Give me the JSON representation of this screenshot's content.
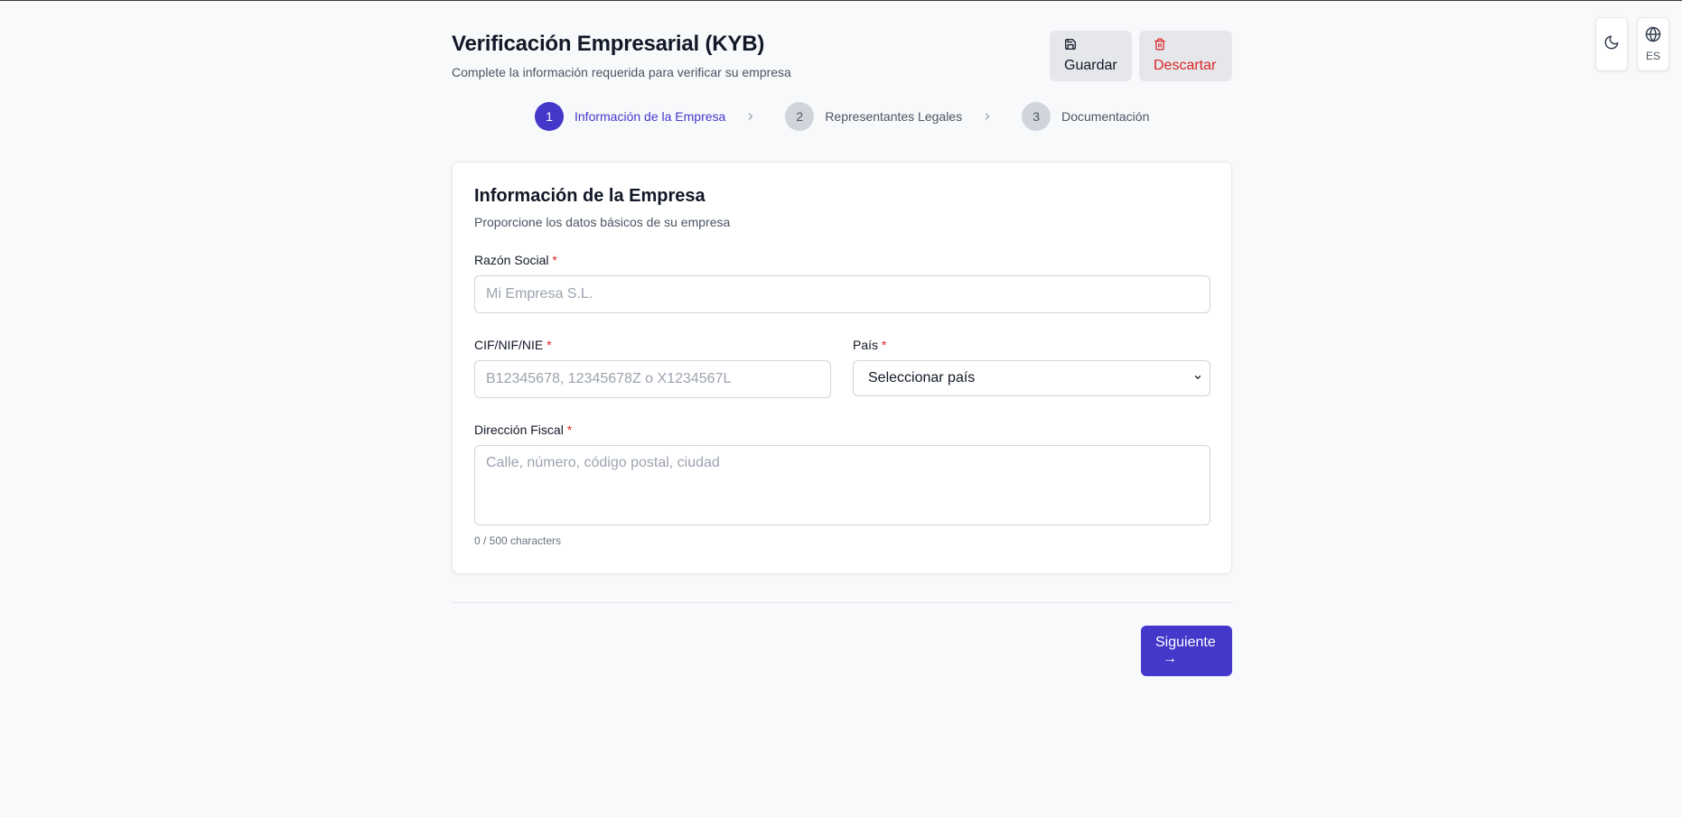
{
  "header": {
    "title": "Verificación Empresarial (KYB)",
    "subtitle": "Complete la información requerida para verificar su empresa",
    "save_label": "Guardar",
    "discard_label": "Descartar"
  },
  "utilities": {
    "theme_icon": "moon-icon",
    "language_icon": "globe-icon",
    "language_code": "ES"
  },
  "steps": [
    {
      "number": "1",
      "label": "Información de la Empresa",
      "active": true
    },
    {
      "number": "2",
      "label": "Representantes Legales",
      "active": false
    },
    {
      "number": "3",
      "label": "Documentación",
      "active": false
    }
  ],
  "card": {
    "title": "Información de la Empresa",
    "subtitle": "Proporcione los datos básicos de su empresa"
  },
  "form": {
    "company_name": {
      "label": "Razón Social",
      "required_mark": "*",
      "placeholder": "Mi Empresa S.L.",
      "value": ""
    },
    "tax_id": {
      "label": "CIF/NIF/NIE",
      "required_mark": "*",
      "placeholder": "B12345678, 12345678Z o X1234567L",
      "value": ""
    },
    "country": {
      "label": "País",
      "required_mark": "*",
      "selected": "Seleccionar país"
    },
    "address": {
      "label": "Dirección Fiscal",
      "required_mark": "*",
      "placeholder": "Calle, número, código postal, ciudad",
      "value": "",
      "counter": "0 / 500 characters"
    }
  },
  "footer": {
    "next_label": "Siguiente",
    "next_arrow": "→"
  },
  "colors": {
    "accent": "#4338ca",
    "danger": "#dc2626",
    "background": "#f8f9fb"
  }
}
